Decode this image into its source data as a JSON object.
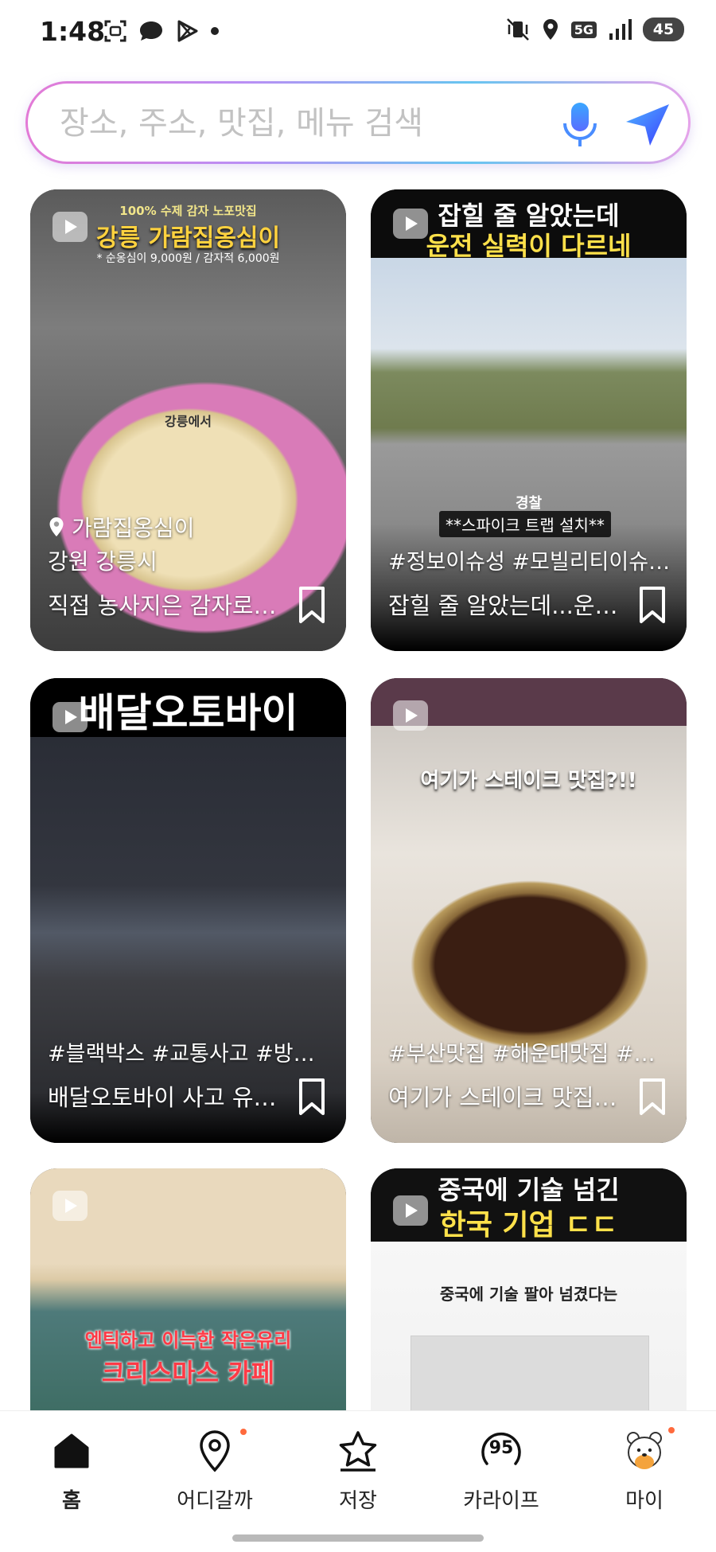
{
  "status_bar": {
    "time": "1:48",
    "network": "5G",
    "battery": "45"
  },
  "search": {
    "placeholder": "장소, 주소, 맛집, 메뉴 검색",
    "value": ""
  },
  "cards": [
    {
      "overlay_small": "100% 수제 감자 노포맛집",
      "overlay_title": "강릉 가람집옹심이",
      "overlay_price": "* 순옹심이 9,000원 / 감자적 6,000원",
      "overlay_mid": "강릉에서",
      "place_name": "가람집옹심이",
      "location": "강원 강릉시",
      "title": "직접 농사지은 감자로…"
    },
    {
      "overlay_line1": "잡힐 줄 알았는데",
      "overlay_line2": "운전 실력이 다르네",
      "overlay_tag1": "경찰",
      "overlay_tag2": "**스파이크 트랩 설치**",
      "hashtags": "#정보이슈성 #모빌리티이슈 …",
      "title": "잡힐 줄 알았는데...운…"
    },
    {
      "overlay_title": "배달오토바이",
      "hashtags": "#블랙박스 #교통사고 #방어…",
      "title": "배달오토바이 사고 유…"
    },
    {
      "overlay_title": "여기가 스테이크 맛집?!!",
      "hashtags": "#부산맛집 #해운대맛집 #센…",
      "title": "여기가 스테이크 맛집…"
    },
    {
      "overlay_line1": "엔틱하고 이늑한 작은유리",
      "overlay_line2": "크리스마스 카페"
    },
    {
      "overlay_line1": "중국에 기술 넘긴",
      "overlay_line2": "한국 기업 ㄷㄷ",
      "overlay_caption": "중국에 기술 팔아 넘겼다는"
    }
  ],
  "nav": [
    {
      "label": "홈",
      "icon": "home-icon"
    },
    {
      "label": "어디갈까",
      "icon": "location-pin-icon"
    },
    {
      "label": "저장",
      "icon": "star-icon"
    },
    {
      "label": "카라이프",
      "icon": "score-badge-icon",
      "badge_value": "95"
    },
    {
      "label": "마이",
      "icon": "bear-avatar-icon"
    }
  ],
  "colors": {
    "accent": "#3d6bff",
    "notify_dot": "#ff6a3d",
    "play_red": "#e8142c"
  }
}
